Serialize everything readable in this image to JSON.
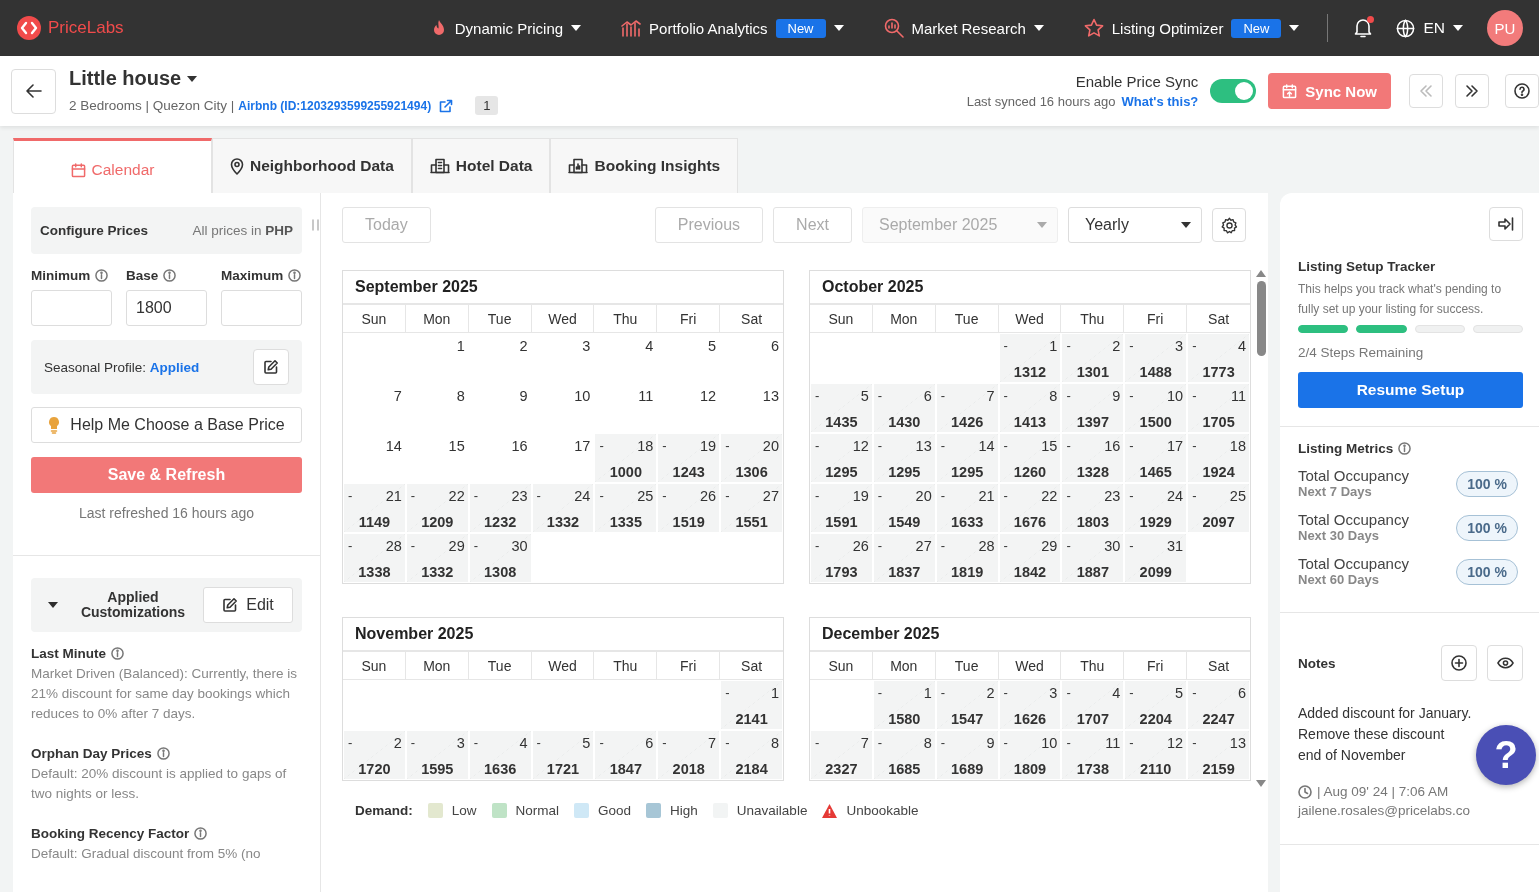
{
  "topbar": {
    "brand": "PriceLabs",
    "nav": [
      {
        "label": "Dynamic Pricing"
      },
      {
        "label": "Portfolio Analytics",
        "badge": "New"
      },
      {
        "label": "Market Research"
      },
      {
        "label": "Listing Optimizer",
        "badge": "New"
      }
    ],
    "language": "EN",
    "avatar": "PU",
    "notifications_unread": true
  },
  "header": {
    "title": "Little house",
    "subtitle": "2 Bedrooms | Quezon City |",
    "link": "Airbnb (ID:1203293599255921494)",
    "count": "1",
    "price_sync": {
      "label": "Enable Price Sync",
      "last_synced": "Last synced 16 hours ago",
      "help_link": "What's this?",
      "on": true
    },
    "sync_button": "Sync Now",
    "prev_disabled": true,
    "next_disabled": false
  },
  "tabs": [
    {
      "label": "Calendar",
      "selected": true
    },
    {
      "label": "Neighborhood Data",
      "selected": false
    },
    {
      "label": "Hotel Data",
      "selected": false
    },
    {
      "label": "Booking Insights",
      "selected": false
    }
  ],
  "left": {
    "configure": {
      "title": "Configure Prices",
      "currency_note": "All prices in ",
      "currency": "PHP"
    },
    "fields": [
      {
        "label": "Minimum"
      },
      {
        "label": "Base",
        "value": "1800"
      },
      {
        "label": "Maximum"
      }
    ],
    "seasonal": {
      "label": "Seasonal Profile: ",
      "status": "Applied"
    },
    "help_button": "Help Me Choose a Base Price",
    "save_button": "Save & Refresh",
    "last_refreshed": "Last refreshed 16 hours ago",
    "customizations": {
      "title": "Applied Customizations",
      "expanded": true,
      "edit": "Edit"
    },
    "rules": [
      {
        "title": "Last Minute",
        "text": "Market Driven (Balanced): Currently, there is 21% discount for same day bookings which reduces to 0% after 7 days."
      },
      {
        "title": "Orphan Day Prices",
        "text": "Default: 20% discount is applied to gaps of two nights or less."
      },
      {
        "title": "Booking Recency Factor",
        "text": "Default: Gradual discount from 5% (no"
      }
    ]
  },
  "toolbar": {
    "today": {
      "label": "Today",
      "disabled": true
    },
    "previous": {
      "label": "Previous",
      "disabled": true
    },
    "next": {
      "label": "Next",
      "disabled": true
    },
    "month": {
      "value": "September 2025",
      "disabled": true
    },
    "view": {
      "value": "Yearly",
      "disabled": false
    }
  },
  "months": [
    {
      "title": "September 2025",
      "weekdays": [
        "Sun",
        "Mon",
        "Tue",
        "Wed",
        "Thu",
        "Fri",
        "Sat"
      ],
      "weeks": [
        [
          {
            "kind": "blank"
          },
          {
            "kind": "plain",
            "day": "1"
          },
          {
            "kind": "plain",
            "day": "2"
          },
          {
            "kind": "plain",
            "day": "3"
          },
          {
            "kind": "plain",
            "day": "4"
          },
          {
            "kind": "plain",
            "day": "5"
          },
          {
            "kind": "plain",
            "day": "6"
          }
        ],
        [
          {
            "kind": "plain",
            "day": "7"
          },
          {
            "kind": "plain",
            "day": "8"
          },
          {
            "kind": "plain",
            "day": "9"
          },
          {
            "kind": "plain",
            "day": "10"
          },
          {
            "kind": "plain",
            "day": "11"
          },
          {
            "kind": "plain",
            "day": "12"
          },
          {
            "kind": "plain",
            "day": "13"
          }
        ],
        [
          {
            "kind": "plain",
            "day": "14"
          },
          {
            "kind": "plain",
            "day": "15"
          },
          {
            "kind": "plain",
            "day": "16"
          },
          {
            "kind": "plain",
            "day": "17"
          },
          {
            "kind": "priced",
            "day": "18",
            "mark": "-",
            "price": "1000"
          },
          {
            "kind": "priced",
            "day": "19",
            "mark": "-",
            "price": "1243"
          },
          {
            "kind": "priced",
            "day": "20",
            "mark": "-",
            "price": "1306"
          }
        ],
        [
          {
            "kind": "priced",
            "day": "21",
            "mark": "-",
            "price": "1149"
          },
          {
            "kind": "priced",
            "day": "22",
            "mark": "-",
            "price": "1209"
          },
          {
            "kind": "priced",
            "day": "23",
            "mark": "-",
            "price": "1232"
          },
          {
            "kind": "priced",
            "day": "24",
            "mark": "-",
            "price": "1332"
          },
          {
            "kind": "priced",
            "day": "25",
            "mark": "-",
            "price": "1335"
          },
          {
            "kind": "priced",
            "day": "26",
            "mark": "-",
            "price": "1519"
          },
          {
            "kind": "priced",
            "day": "27",
            "mark": "-",
            "price": "1551"
          }
        ],
        [
          {
            "kind": "priced",
            "day": "28",
            "mark": "-",
            "price": "1338"
          },
          {
            "kind": "priced",
            "day": "29",
            "mark": "-",
            "price": "1332"
          },
          {
            "kind": "priced",
            "day": "30",
            "mark": "-",
            "price": "1308"
          },
          {
            "kind": "blank"
          },
          {
            "kind": "blank"
          },
          {
            "kind": "blank"
          },
          {
            "kind": "blank"
          }
        ]
      ]
    },
    {
      "title": "October 2025",
      "weekdays": [
        "Sun",
        "Mon",
        "Tue",
        "Wed",
        "Thu",
        "Fri",
        "Sat"
      ],
      "weeks": [
        [
          {
            "kind": "blank"
          },
          {
            "kind": "blank"
          },
          {
            "kind": "blank"
          },
          {
            "kind": "priced",
            "day": "1",
            "mark": "-",
            "price": "1312"
          },
          {
            "kind": "priced",
            "day": "2",
            "mark": "-",
            "price": "1301"
          },
          {
            "kind": "priced",
            "day": "3",
            "mark": "-",
            "price": "1488"
          },
          {
            "kind": "priced",
            "day": "4",
            "mark": "-",
            "price": "1773"
          }
        ],
        [
          {
            "kind": "priced",
            "day": "5",
            "mark": "-",
            "price": "1435"
          },
          {
            "kind": "priced",
            "day": "6",
            "mark": "-",
            "price": "1430"
          },
          {
            "kind": "priced",
            "day": "7",
            "mark": "-",
            "price": "1426"
          },
          {
            "kind": "priced",
            "day": "8",
            "mark": "-",
            "price": "1413"
          },
          {
            "kind": "priced",
            "day": "9",
            "mark": "-",
            "price": "1397"
          },
          {
            "kind": "priced",
            "day": "10",
            "mark": "-",
            "price": "1500"
          },
          {
            "kind": "priced",
            "day": "11",
            "mark": "-",
            "price": "1705"
          }
        ],
        [
          {
            "kind": "priced",
            "day": "12",
            "mark": "-",
            "price": "1295"
          },
          {
            "kind": "priced",
            "day": "13",
            "mark": "-",
            "price": "1295"
          },
          {
            "kind": "priced",
            "day": "14",
            "mark": "-",
            "price": "1295"
          },
          {
            "kind": "priced",
            "day": "15",
            "mark": "-",
            "price": "1260"
          },
          {
            "kind": "priced",
            "day": "16",
            "mark": "-",
            "price": "1328"
          },
          {
            "kind": "priced",
            "day": "17",
            "mark": "-",
            "price": "1465"
          },
          {
            "kind": "priced",
            "day": "18",
            "mark": "-",
            "price": "1924"
          }
        ],
        [
          {
            "kind": "priced",
            "day": "19",
            "mark": "-",
            "price": "1591"
          },
          {
            "kind": "priced",
            "day": "20",
            "mark": "-",
            "price": "1549"
          },
          {
            "kind": "priced",
            "day": "21",
            "mark": "-",
            "price": "1633"
          },
          {
            "kind": "priced",
            "day": "22",
            "mark": "-",
            "price": "1676"
          },
          {
            "kind": "priced",
            "day": "23",
            "mark": "-",
            "price": "1803"
          },
          {
            "kind": "priced",
            "day": "24",
            "mark": "-",
            "price": "1929"
          },
          {
            "kind": "priced",
            "day": "25",
            "mark": "-",
            "price": "2097"
          }
        ],
        [
          {
            "kind": "priced",
            "day": "26",
            "mark": "-",
            "price": "1793"
          },
          {
            "kind": "priced",
            "day": "27",
            "mark": "-",
            "price": "1837"
          },
          {
            "kind": "priced",
            "day": "28",
            "mark": "-",
            "price": "1819"
          },
          {
            "kind": "priced",
            "day": "29",
            "mark": "-",
            "price": "1842"
          },
          {
            "kind": "priced",
            "day": "30",
            "mark": "-",
            "price": "1887"
          },
          {
            "kind": "priced",
            "day": "31",
            "mark": "-",
            "price": "2099"
          },
          {
            "kind": "blank"
          }
        ]
      ]
    },
    {
      "title": "November 2025",
      "weekdays": [
        "Sun",
        "Mon",
        "Tue",
        "Wed",
        "Thu",
        "Fri",
        "Sat"
      ],
      "weeks": [
        [
          {
            "kind": "blank"
          },
          {
            "kind": "blank"
          },
          {
            "kind": "blank"
          },
          {
            "kind": "blank"
          },
          {
            "kind": "blank"
          },
          {
            "kind": "blank"
          },
          {
            "kind": "priced",
            "day": "1",
            "mark": "-",
            "price": "2141"
          }
        ],
        [
          {
            "kind": "priced",
            "day": "2",
            "mark": "-",
            "price": "1720"
          },
          {
            "kind": "priced",
            "day": "3",
            "mark": "-",
            "price": "1595"
          },
          {
            "kind": "priced",
            "day": "4",
            "mark": "-",
            "price": "1636"
          },
          {
            "kind": "priced",
            "day": "5",
            "mark": "-",
            "price": "1721"
          },
          {
            "kind": "priced",
            "day": "6",
            "mark": "-",
            "price": "1847"
          },
          {
            "kind": "priced",
            "day": "7",
            "mark": "-",
            "price": "2018"
          },
          {
            "kind": "priced",
            "day": "8",
            "mark": "-",
            "price": "2184"
          }
        ]
      ]
    },
    {
      "title": "December 2025",
      "weekdays": [
        "Sun",
        "Mon",
        "Tue",
        "Wed",
        "Thu",
        "Fri",
        "Sat"
      ],
      "weeks": [
        [
          {
            "kind": "blank"
          },
          {
            "kind": "priced",
            "day": "1",
            "mark": "-",
            "price": "1580"
          },
          {
            "kind": "priced",
            "day": "2",
            "mark": "-",
            "price": "1547"
          },
          {
            "kind": "priced",
            "day": "3",
            "mark": "-",
            "price": "1626"
          },
          {
            "kind": "priced",
            "day": "4",
            "mark": "-",
            "price": "1707"
          },
          {
            "kind": "priced",
            "day": "5",
            "mark": "-",
            "price": "2204"
          },
          {
            "kind": "priced",
            "day": "6",
            "mark": "-",
            "price": "2247"
          }
        ],
        [
          {
            "kind": "priced",
            "day": "7",
            "mark": "-",
            "price": "2327"
          },
          {
            "kind": "priced",
            "day": "8",
            "mark": "-",
            "price": "1685"
          },
          {
            "kind": "priced",
            "day": "9",
            "mark": "-",
            "price": "1689"
          },
          {
            "kind": "priced",
            "day": "10",
            "mark": "-",
            "price": "1809"
          },
          {
            "kind": "priced",
            "day": "11",
            "mark": "-",
            "price": "1738"
          },
          {
            "kind": "priced",
            "day": "12",
            "mark": "-",
            "price": "2110"
          },
          {
            "kind": "priced",
            "day": "13",
            "mark": "-",
            "price": "2159"
          }
        ]
      ]
    }
  ],
  "legend": {
    "title": "Demand:",
    "items": [
      {
        "kind": "swatch",
        "label": "Low",
        "color": "#e3e8cf"
      },
      {
        "kind": "swatch",
        "label": "Normal",
        "color": "#bfe3c6"
      },
      {
        "kind": "swatch",
        "label": "Good",
        "color": "#cfe8f6"
      },
      {
        "kind": "swatch",
        "label": "High",
        "color": "#a7c6d6"
      },
      {
        "kind": "swatch",
        "label": "Unavailable",
        "color": "#f2f4f4"
      },
      {
        "kind": "warning",
        "label": "Unbookable",
        "color": "#e53935"
      }
    ]
  },
  "right": {
    "tracker": {
      "title": "Listing Setup Tracker",
      "text": "This helps you track what's pending to fully set up your listing for success.",
      "steps": [
        {
          "done": true
        },
        {
          "done": true
        },
        {
          "done": false
        },
        {
          "done": false
        }
      ],
      "remaining": "2/4 Steps Remaining",
      "button": "Resume Setup"
    },
    "metrics": {
      "title": "Listing Metrics",
      "items": [
        {
          "label": "Total Occupancy",
          "period": "Next 7 Days",
          "value": "100 %"
        },
        {
          "label": "Total Occupancy",
          "period": "Next 30 Days",
          "value": "100 %"
        },
        {
          "label": "Total Occupancy",
          "period": "Next 60 Days",
          "value": "100 %"
        }
      ]
    },
    "notes": {
      "title": "Notes",
      "lines": [
        "Added discount for January.",
        "Remove these discount",
        "end of November"
      ],
      "meta": "| Aug 09' 24 | 7:06 AM",
      "author": "jailene.rosales@pricelabs.co"
    }
  },
  "help_fab": "?"
}
